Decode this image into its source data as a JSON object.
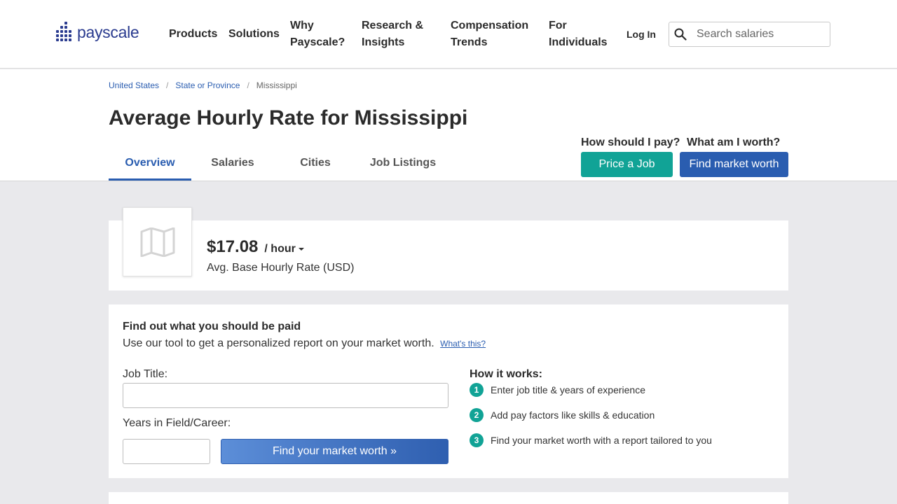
{
  "brand": {
    "name": "payscale",
    "color": "#2a3b8f"
  },
  "nav": {
    "items": [
      {
        "label_line1": "Products",
        "label_line2": ""
      },
      {
        "label_line1": "Solutions",
        "label_line2": ""
      },
      {
        "label_line1": "Why",
        "label_line2": "Payscale?"
      },
      {
        "label_line1": "Research &",
        "label_line2": "Insights"
      },
      {
        "label_line1": "Compensation",
        "label_line2": "Trends"
      },
      {
        "label_line1": "For",
        "label_line2": "Individuals"
      }
    ],
    "login": "Log In",
    "search_placeholder": "Search salaries"
  },
  "breadcrumb": [
    "United States",
    "State or Province",
    "Mississippi"
  ],
  "page_title": "Average Hourly Rate for Mississippi",
  "tabs": [
    "Overview",
    "Salaries",
    "Cities",
    "Job Listings"
  ],
  "cta": {
    "pay_question": "How should I pay?",
    "pay_button": "Price a Job",
    "worth_question": "What am I worth?",
    "worth_button": "Find market worth",
    "pay_color": "#11a396",
    "worth_color": "#2a5db0"
  },
  "rate": {
    "value": "$17.08",
    "unit": "/ hour",
    "description": "Avg. Base Hourly Rate (USD)"
  },
  "form": {
    "title": "Find out what you should be paid",
    "subtitle": "Use our tool to get a personalized report on your market worth.",
    "whats_this": "What's this?",
    "job_title_label": "Job Title:",
    "job_title_value": "",
    "years_label": "Years in Field/Career:",
    "years_value": "",
    "submit": "Find your market worth »"
  },
  "how_it_works": {
    "title": "How it works:",
    "steps": [
      {
        "num": "1",
        "text": "Enter job title & years of experience"
      },
      {
        "num": "2",
        "text": "Add pay factors like skills & education"
      },
      {
        "num": "3",
        "text": "Find your market worth with a report tailored to you"
      }
    ]
  }
}
